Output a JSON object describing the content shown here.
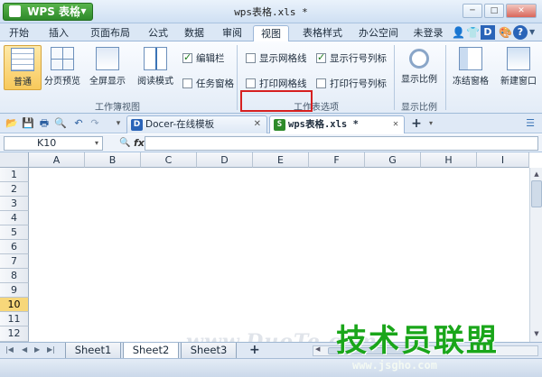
{
  "app": {
    "name": "WPS 表格",
    "window_title": "wps表格.xls *"
  },
  "menu_tabs": [
    "开始",
    "插入",
    "页面布局",
    "公式",
    "数据",
    "审阅",
    "视图",
    "表格样式",
    "办公空间"
  ],
  "active_tab": "视图",
  "login_label": "未登录",
  "ribbon": {
    "btn_normal": "普通",
    "btn_page_break": "分页预览",
    "btn_fullscreen": "全屏显示",
    "btn_reading": "阅读模式",
    "chk_edit_bar": "编辑栏",
    "chk_task_pane": "任务窗格",
    "chk_show_grid": "显示网格线",
    "chk_print_grid": "打印网格线",
    "chk_show_headers": "显示行号列标",
    "chk_print_headers": "打印行号列标",
    "btn_zoom": "显示比例",
    "btn_freeze": "冻结窗格",
    "btn_new_window": "新建窗口",
    "group_workbook_view": "工作簿视图",
    "group_display_options": "工作表选项",
    "group_zoom": "显示比例",
    "checked": {
      "edit_bar": true,
      "task_pane": false,
      "show_grid": false,
      "print_grid": false,
      "show_headers": true,
      "print_headers": false
    }
  },
  "doc_tabs": [
    {
      "icon": "D",
      "label": "Docer-在线模板"
    },
    {
      "icon": "S",
      "label": "wps表格.xls *"
    }
  ],
  "formula_bar": {
    "name_box": "K10",
    "fx": "fx"
  },
  "columns": [
    "A",
    "B",
    "C",
    "D",
    "E",
    "F",
    "G",
    "H",
    "I"
  ],
  "rows": [
    "1",
    "2",
    "3",
    "4",
    "5",
    "6",
    "7",
    "8",
    "9",
    "10",
    "11",
    "12"
  ],
  "selected_row": "10",
  "watermark": "www.DuoTe.com",
  "sheets": [
    "Sheet1",
    "Sheet2",
    "Sheet3"
  ],
  "active_sheet": "Sheet2",
  "site_brand": {
    "name": "技术员联盟",
    "url": "www.jsgho.com"
  },
  "colors": {
    "accent_green": "#2e8a2a",
    "highlight_red": "#d62020",
    "selection_yellow": "#f7d77a"
  }
}
